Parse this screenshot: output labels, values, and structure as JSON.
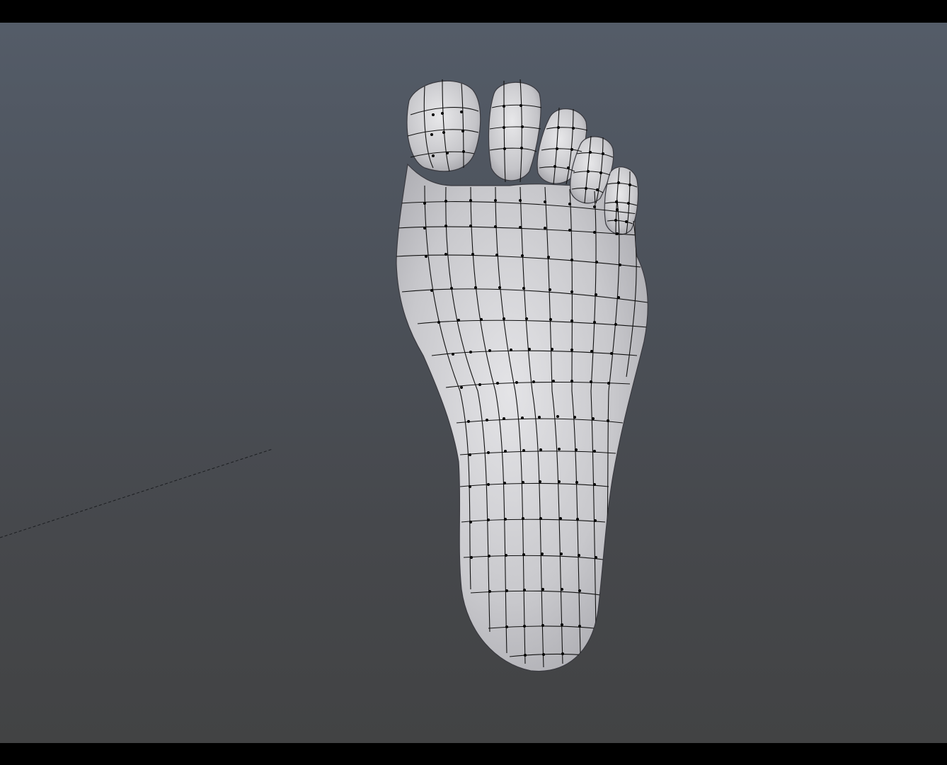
{
  "viewport": {
    "mode": "perspective",
    "background_top": "#545c68",
    "background_bottom": "#424344",
    "mesh": {
      "object": "foot",
      "display": "wireframe-on-shaded",
      "surface_color": "#c9c9cc",
      "wire_color": "#111111"
    },
    "grid_axis_line": "dashed"
  }
}
